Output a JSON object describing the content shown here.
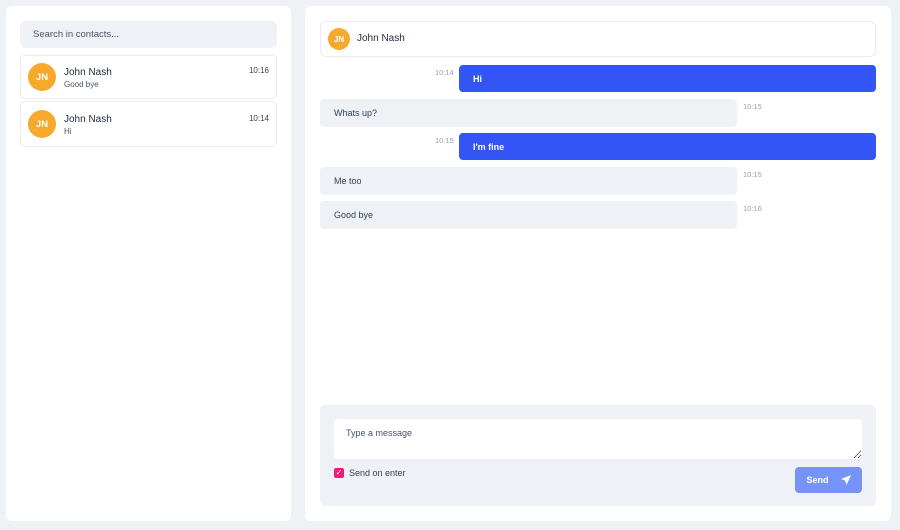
{
  "sidebar": {
    "search_placeholder": "Search in contacts...",
    "contacts": [
      {
        "initials": "JN",
        "name": "John Nash",
        "last_message": "Good bye",
        "time": "10:16"
      },
      {
        "initials": "JN",
        "name": "John Nash",
        "last_message": "Hi",
        "time": "10:14"
      }
    ]
  },
  "chat": {
    "header": {
      "initials": "JN",
      "name": "John Nash"
    },
    "messages": [
      {
        "text": "Hi",
        "time": "10:14",
        "direction": "sent"
      },
      {
        "text": "Whats up?",
        "time": "10:15",
        "direction": "received"
      },
      {
        "text": "I'm fine",
        "time": "10:15",
        "direction": "sent"
      },
      {
        "text": "Me too",
        "time": "10:15",
        "direction": "received"
      },
      {
        "text": "Good bye",
        "time": "10:16",
        "direction": "received"
      }
    ]
  },
  "composer": {
    "placeholder": "Type a message",
    "send_on_enter_label": "Send on enter",
    "send_on_enter": true,
    "send_label": "Send"
  },
  "colors": {
    "accent": "#3355f6",
    "avatar": "#f6a92c",
    "checkbox": "#e91e78"
  }
}
